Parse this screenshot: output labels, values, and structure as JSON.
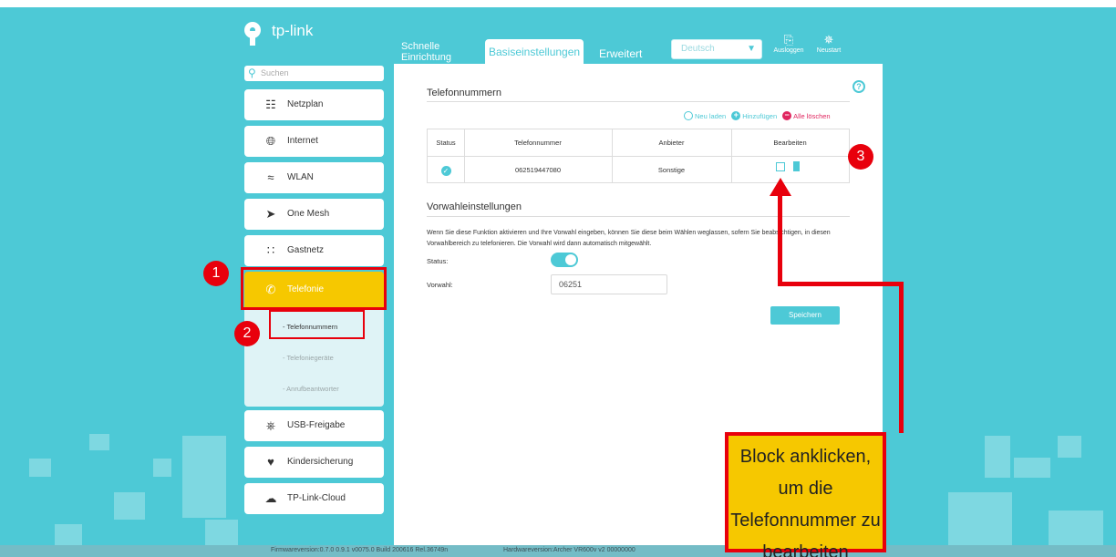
{
  "brand": {
    "logo_text": "tp-link"
  },
  "top_nav": {
    "tabs": [
      {
        "label": "Schnelle Einrichtung"
      },
      {
        "label": "Basiseinstellungen",
        "active": true
      },
      {
        "label": "Erweitert"
      }
    ],
    "language": "Deutsch",
    "logout_label": "Ausloggen",
    "restart_label": "Neustart"
  },
  "sidebar": {
    "search_placeholder": "Suchen",
    "items": [
      {
        "label": "Netzplan",
        "icon": "network-map-icon"
      },
      {
        "label": "Internet",
        "icon": "globe-icon"
      },
      {
        "label": "WLAN",
        "icon": "wifi-icon"
      },
      {
        "label": "One Mesh",
        "icon": "mesh-icon"
      },
      {
        "label": "Gastnetz",
        "icon": "guest-network-icon"
      },
      {
        "label": "Telefonie",
        "icon": "phone-icon",
        "active": true
      },
      {
        "label": "USB-Freigabe",
        "icon": "usb-icon"
      },
      {
        "label": "Kindersicherung",
        "icon": "parental-heart-icon"
      },
      {
        "label": "TP-Link-Cloud",
        "icon": "cloud-icon"
      }
    ],
    "sub_items": [
      {
        "label": "- Telefonnummern",
        "active": true
      },
      {
        "label": "- Telefoniegeräte"
      },
      {
        "label": "- Anrufbeantworter"
      }
    ]
  },
  "main": {
    "phone_section_title": "Telefonnummern",
    "actions": {
      "reload": "Neu laden",
      "add": "Hinzufügen",
      "delete_all": "Alle löschen"
    },
    "table": {
      "headers": [
        "Status",
        "Telefonnummer",
        "Anbieter",
        "Bearbeiten"
      ],
      "rows": [
        {
          "status": "enabled",
          "number": "062519447080",
          "provider": "Sonstige"
        }
      ]
    },
    "prefix_section_title": "Vorwahleinstellungen",
    "prefix_description": "Wenn Sie diese Funktion aktivieren und Ihre Vorwahl eingeben, können Sie diese beim Wählen weglassen, sofern Sie beabsichtigen, in diesen Vorwahlbereich zu telefonieren. Die Vorwahl wird dann automatisch mitgewählt.",
    "status_label": "Status:",
    "status_enabled": true,
    "prefix_label": "Vorwahl:",
    "prefix_value": "06251",
    "save_label": "Speichern"
  },
  "footer": {
    "firmware": "Firmwareversion:0.7.0 0.9.1 v0075.0 Build 200616 Rel.36749n",
    "hardware": "Hardwareversion:Archer VR600v v2 00000000"
  },
  "annotations": {
    "badge_1": "1",
    "badge_2": "2",
    "badge_3": "3",
    "callout_text": "Block anklicken, um die Telefonnummer zu bearbeiten"
  },
  "colors": {
    "teal": "#4dc9d6",
    "active_yellow": "#f6c800",
    "annotation_red": "#e8000c",
    "delete_pink": "#e0265f"
  }
}
